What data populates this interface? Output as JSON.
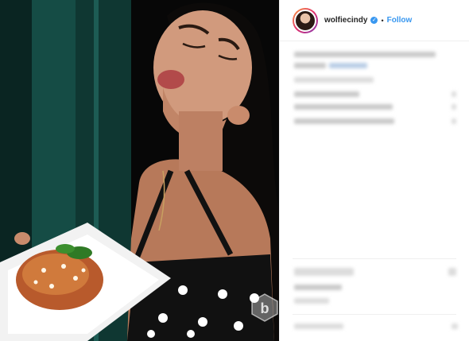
{
  "post": {
    "username": "wolfiecindy",
    "verified": true,
    "separator": "•",
    "follow_label": "Follow"
  },
  "photo": {
    "description_icon": "photo-image"
  },
  "watermark": {
    "letter": "b"
  },
  "colors": {
    "follow_blue": "#3897f0",
    "divider": "#efefef"
  }
}
